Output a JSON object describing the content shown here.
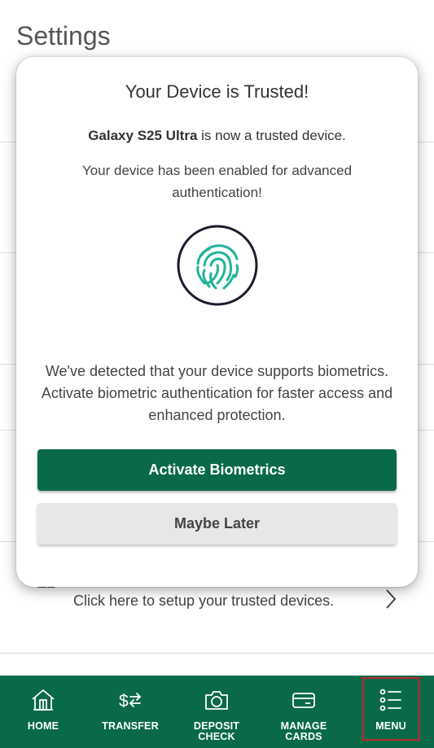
{
  "page": {
    "title": "Settings"
  },
  "trusted_row": {
    "text": "Click here to setup your trusted devices."
  },
  "modal": {
    "title": "Your Device is Trusted!",
    "device_name": "Galaxy S25 Ultra",
    "device_suffix": " is now a trusted device.",
    "enabled_text": "Your device has been enabled for advanced authentication!",
    "biometrics_text": "We've detected that your device supports biometrics. Activate biometric authentication for faster access and enhanced protection.",
    "activate_button": "Activate Biometrics",
    "later_button": "Maybe Later"
  },
  "nav": {
    "home": "HOME",
    "transfer": "TRANSFER",
    "deposit_line1": "DEPOSIT",
    "deposit_line2": "CHECK",
    "manage_line1": "MANAGE",
    "manage_line2": "CARDS",
    "menu": "MENU"
  },
  "colors": {
    "brand_green": "#0a6a48",
    "fingerprint_teal": "#21b39a",
    "highlight_red": "#c0262d"
  },
  "icons": [
    "home-icon",
    "transfer-icon",
    "camera-icon",
    "card-icon",
    "menu-list-icon",
    "fingerprint-icon",
    "chevron-right-icon"
  ]
}
